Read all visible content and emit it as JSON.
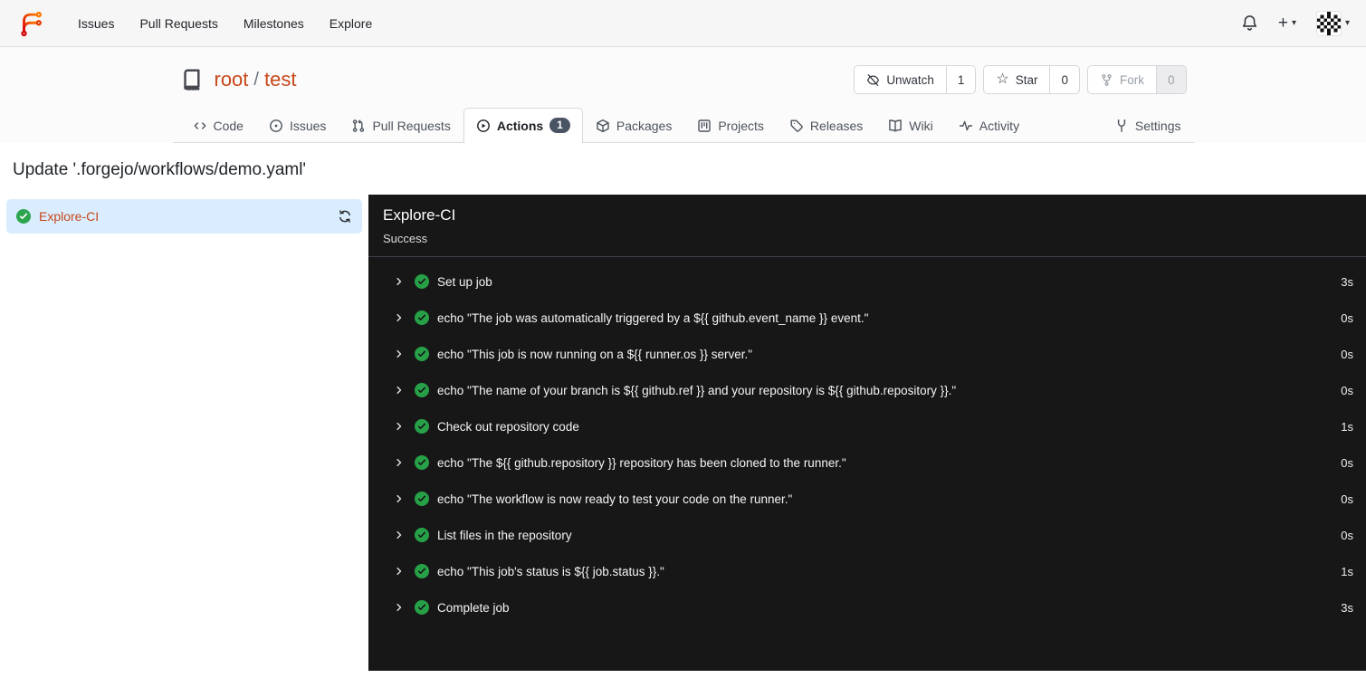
{
  "colors": {
    "accent_link": "#c8471a",
    "success_green": "#2da44e",
    "selected_job_bg": "#d9edff",
    "badge_bg": "#495465",
    "panel_bg": "#171717"
  },
  "icons": {
    "caret_down": "▾",
    "plus": "+",
    "star": "☆"
  },
  "navbar": {
    "items": [
      {
        "label": "Issues"
      },
      {
        "label": "Pull Requests"
      },
      {
        "label": "Milestones"
      },
      {
        "label": "Explore"
      }
    ]
  },
  "repo_header": {
    "owner": "root",
    "separator": "/",
    "name": "test",
    "buttons": {
      "unwatch": {
        "label": "Unwatch",
        "count": "1"
      },
      "star": {
        "label": "Star",
        "count": "0"
      },
      "fork": {
        "label": "Fork",
        "count": "0"
      }
    }
  },
  "tabs": [
    {
      "label": "Code"
    },
    {
      "label": "Issues"
    },
    {
      "label": "Pull Requests"
    },
    {
      "label": "Actions",
      "badge": "1"
    },
    {
      "label": "Packages"
    },
    {
      "label": "Projects"
    },
    {
      "label": "Releases"
    },
    {
      "label": "Wiki"
    },
    {
      "label": "Activity"
    },
    {
      "label": "Settings"
    }
  ],
  "page": {
    "title": "Update '.forgejo/workflows/demo.yaml'"
  },
  "sidebar": {
    "job": {
      "label": "Explore-CI"
    }
  },
  "run_panel": {
    "title": "Explore-CI",
    "status": "Success",
    "steps": [
      {
        "name": "Set up job",
        "duration": "3s"
      },
      {
        "name": "echo \"The job was automatically triggered by a ${{ github.event_name }} event.\"",
        "duration": "0s"
      },
      {
        "name": "echo \"This job is now running on a ${{ runner.os }} server.\"",
        "duration": "0s"
      },
      {
        "name": "echo \"The name of your branch is ${{ github.ref }} and your repository is ${{ github.repository }}.\"",
        "duration": "0s"
      },
      {
        "name": "Check out repository code",
        "duration": "1s"
      },
      {
        "name": "echo \"The ${{ github.repository }} repository has been cloned to the runner.\"",
        "duration": "0s"
      },
      {
        "name": "echo \"The workflow is now ready to test your code on the runner.\"",
        "duration": "0s"
      },
      {
        "name": "List files in the repository",
        "duration": "0s"
      },
      {
        "name": "echo \"This job's status is ${{ job.status }}.\"",
        "duration": "1s"
      },
      {
        "name": "Complete job",
        "duration": "3s"
      }
    ]
  }
}
